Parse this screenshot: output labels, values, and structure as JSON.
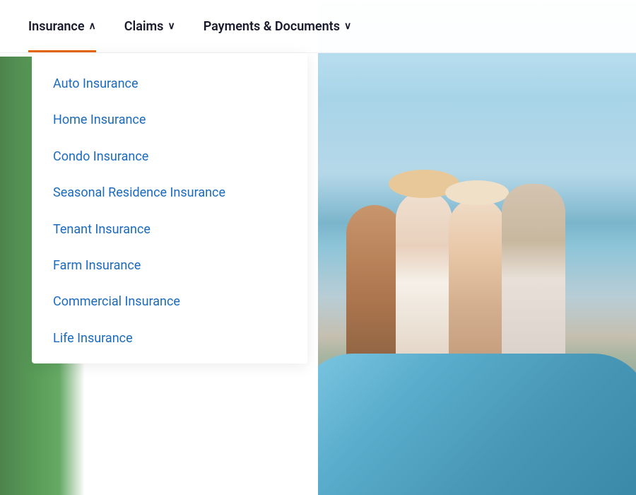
{
  "navbar": {
    "items": [
      {
        "id": "insurance",
        "label": "Insurance",
        "chevron": "∧",
        "active": true
      },
      {
        "id": "claims",
        "label": "Claims",
        "chevron": "∨",
        "active": false
      },
      {
        "id": "payments-documents",
        "label": "Payments & Documents",
        "chevron": "∨",
        "active": false
      }
    ]
  },
  "dropdown": {
    "items": [
      {
        "id": "auto-insurance",
        "label": "Auto Insurance"
      },
      {
        "id": "home-insurance",
        "label": "Home Insurance"
      },
      {
        "id": "condo-insurance",
        "label": "Condo Insurance"
      },
      {
        "id": "seasonal-residence-insurance",
        "label": "Seasonal Residence Insurance"
      },
      {
        "id": "tenant-insurance",
        "label": "Tenant Insurance"
      },
      {
        "id": "farm-insurance",
        "label": "Farm Insurance"
      },
      {
        "id": "commercial-insurance",
        "label": "Commercial Insurance"
      },
      {
        "id": "life-insurance",
        "label": "Life Insurance"
      }
    ]
  }
}
